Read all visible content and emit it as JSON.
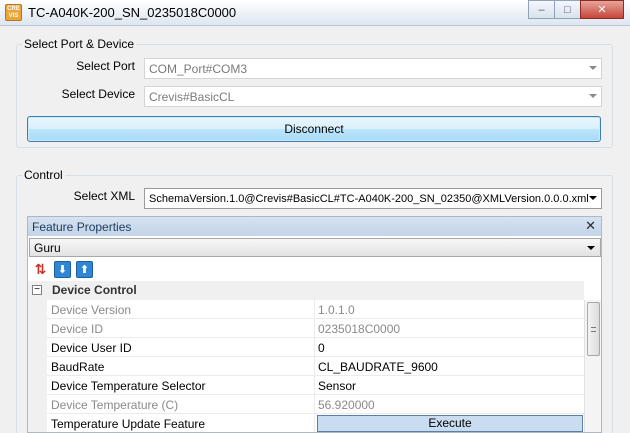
{
  "window": {
    "title": "TC-A040K-200_SN_0235018C0000",
    "app_icon_text": "CRE VIS",
    "minimize_glyph": "–",
    "maximize_glyph": "□",
    "close_glyph": "✕"
  },
  "port_device": {
    "group_title": "Select  Port & Device",
    "port_label": "Select Port",
    "port_value": "COM_Port#COM3",
    "device_label": "Select Device",
    "device_value": "Crevis#BasicCL",
    "disconnect_label": "Disconnect"
  },
  "control": {
    "group_title": "Control",
    "xml_label": "Select XML",
    "xml_value": "SchemaVersion.1.0@Crevis#BasicCL#TC-A040K-200_SN_02350@XMLVersion.0.0.0.xml"
  },
  "feature_properties": {
    "title": "Feature Properties",
    "close_glyph": "✕",
    "visibility_value": "Guru",
    "toolbar": [
      {
        "name": "refresh-icon",
        "glyph": "⇅"
      },
      {
        "name": "download-icon",
        "glyph": "⬇"
      },
      {
        "name": "upload-icon",
        "glyph": "⬆"
      }
    ],
    "category": {
      "expander": "−",
      "label": "Device Control"
    },
    "rows": [
      {
        "name": "Device Version",
        "value": "1.0.1.0",
        "readonly": true
      },
      {
        "name": "Device ID",
        "value": "0235018C0000",
        "readonly": true
      },
      {
        "name": "Device User ID",
        "value": "0",
        "readonly": false
      },
      {
        "name": "BaudRate",
        "value": "CL_BAUDRATE_9600",
        "readonly": false
      },
      {
        "name": "Device Temperature Selector",
        "value": "Sensor",
        "readonly": false
      },
      {
        "name": "Device Temperature (C)",
        "value": "56.920000",
        "readonly": true
      },
      {
        "name": "Temperature Update Feature",
        "value": "Execute",
        "readonly": false,
        "button": true
      }
    ]
  }
}
